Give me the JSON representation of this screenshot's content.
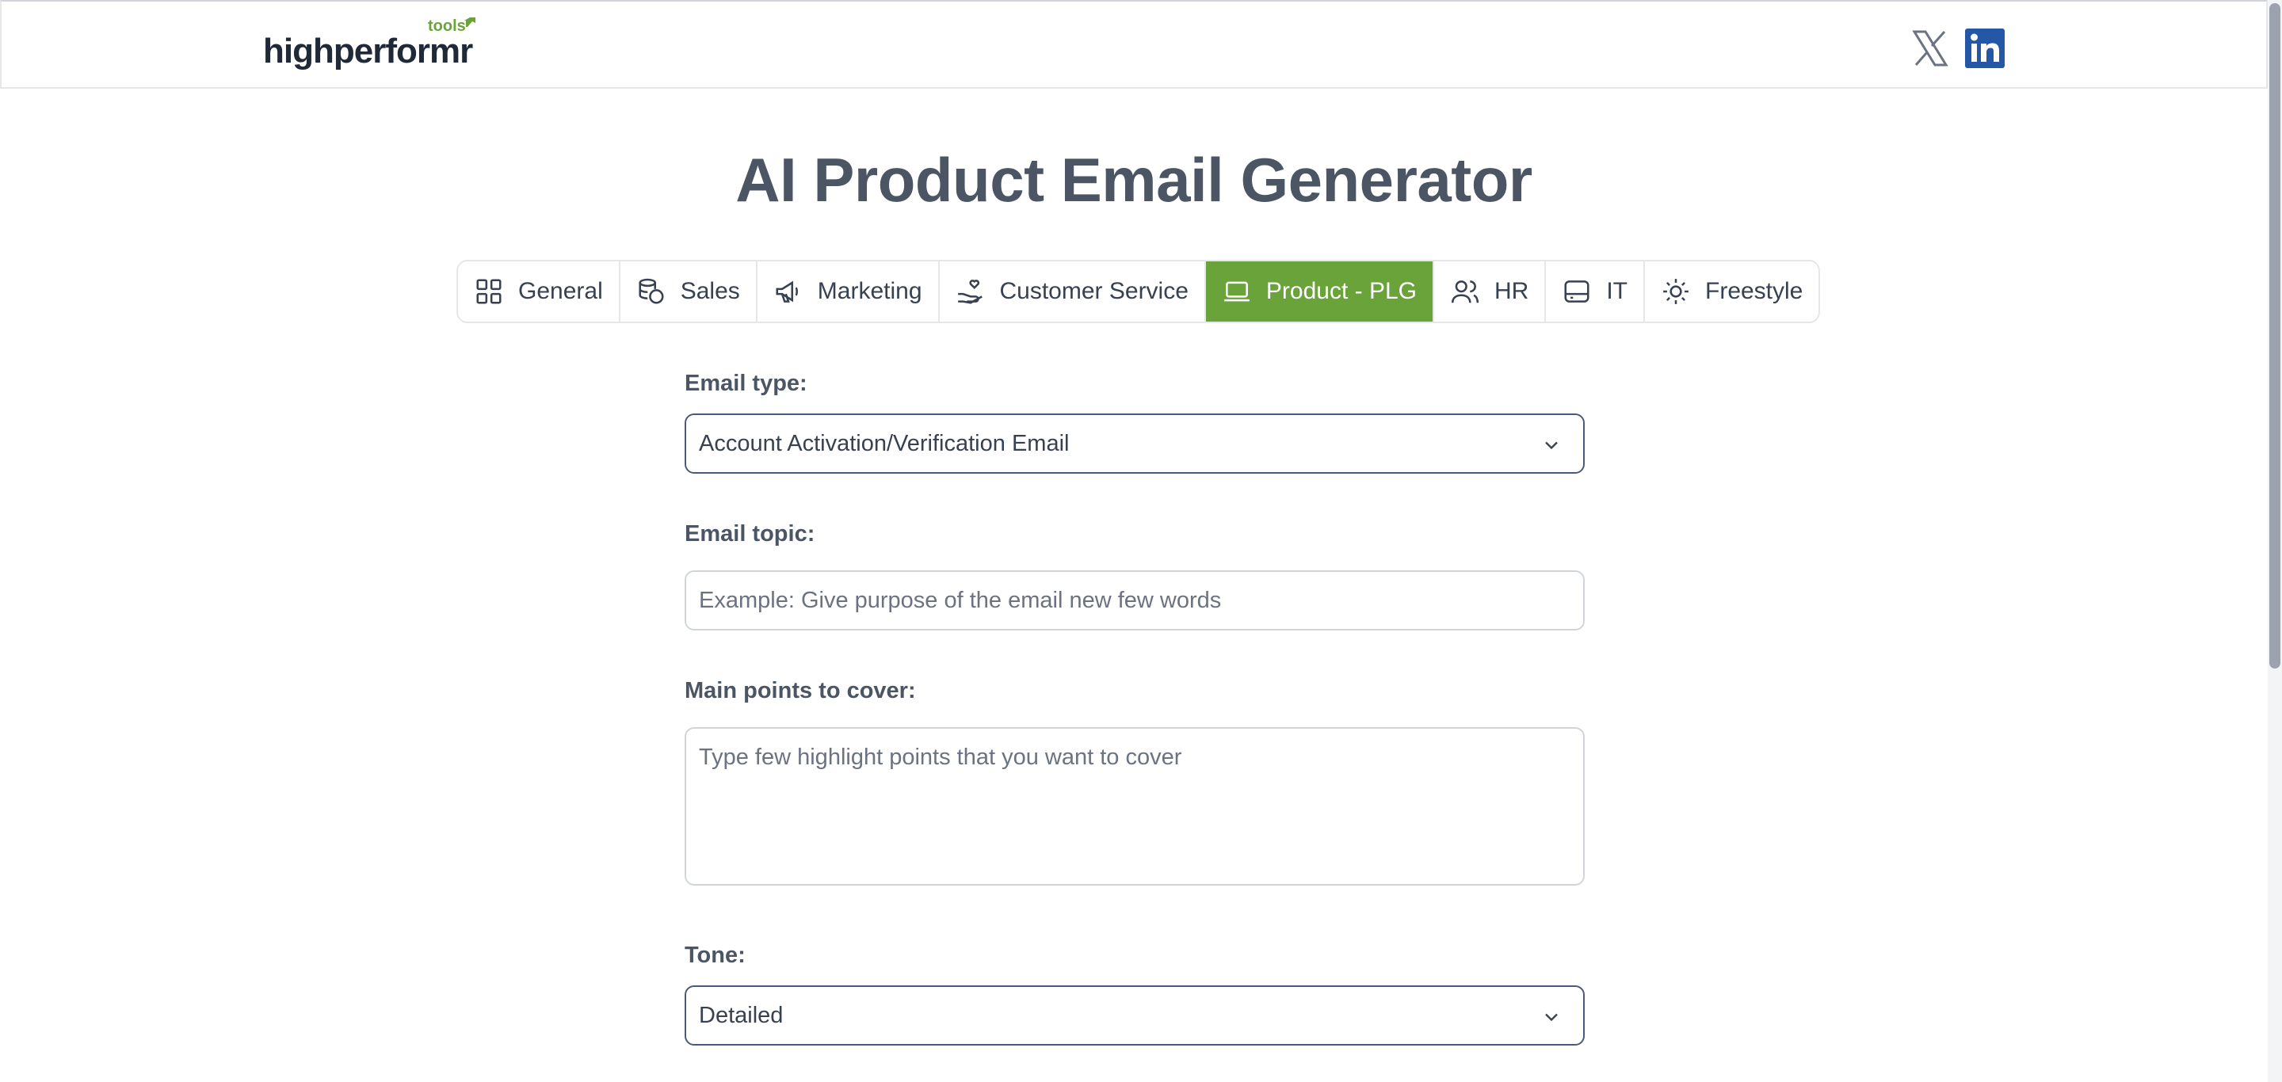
{
  "brand": {
    "name": "highperformr",
    "suffix": "tools",
    "accent": "#6aa33a"
  },
  "social": [
    {
      "name": "x-twitter",
      "icon": "x-logo-icon"
    },
    {
      "name": "linkedin",
      "icon": "linkedin-icon",
      "color": "#2557a7"
    }
  ],
  "page": {
    "title": "AI Product Email Generator"
  },
  "tabs": [
    {
      "label": "General",
      "icon": "grid-icon",
      "active": false
    },
    {
      "label": "Sales",
      "icon": "coins-icon",
      "active": false
    },
    {
      "label": "Marketing",
      "icon": "megaphone-icon",
      "active": false
    },
    {
      "label": "Customer Service",
      "icon": "hand-heart-icon",
      "active": false
    },
    {
      "label": "Product - PLG",
      "icon": "laptop-icon",
      "active": true
    },
    {
      "label": "HR",
      "icon": "users-icon",
      "active": false
    },
    {
      "label": "IT",
      "icon": "hard-drive-icon",
      "active": false
    },
    {
      "label": "Freestyle",
      "icon": "sun-icon",
      "active": false
    }
  ],
  "form": {
    "email_type": {
      "label": "Email type:",
      "value": "Account Activation/Verification Email"
    },
    "email_topic": {
      "label": "Email topic:",
      "placeholder": "Example: Give purpose of the email new few words"
    },
    "main_points": {
      "label": "Main points to cover:",
      "placeholder": "Type few highlight points that you want to cover"
    },
    "tone": {
      "label": "Tone:",
      "value": "Detailed"
    }
  }
}
